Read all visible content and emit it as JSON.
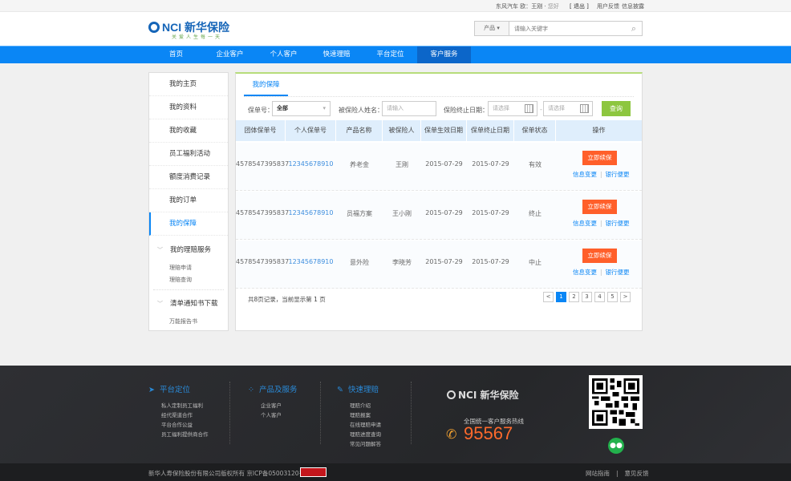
{
  "topbar": {
    "greeting": "东风汽车 ",
    "user_prefix": "欧：王刚 · ",
    "hello": "您好",
    "logout": "[ 退出 ]",
    "feedback": "用户反馈",
    "disclosure": "信息披露"
  },
  "header": {
    "logo_text": "NCI 新华保险",
    "slogan": "关爱人生每一天",
    "search_category": "产品",
    "search_placeholder": "请输入关键字"
  },
  "nav": {
    "items": [
      "首页",
      "企业客户",
      "个人客户",
      "快速理赔",
      "平台定位",
      "客户服务"
    ],
    "active": "客户服务",
    "color": "#0a86f5"
  },
  "sidebar": {
    "items": [
      "我的主页",
      "我的资料",
      "我的收藏",
      "员工福利活动",
      "额度消费记录",
      "我的订单",
      "我的保障"
    ],
    "active": "我的保障",
    "groups": [
      {
        "title": "我的理赔服务",
        "subs": [
          "理赔申请",
          "理赔查询"
        ]
      },
      {
        "title": "清单通知书下载",
        "subs": [
          "万能报告书"
        ]
      }
    ]
  },
  "main": {
    "tab": "我的保障",
    "filters": {
      "policy_label": "保单号：",
      "policy_value": "全部",
      "insured_label": "被保险人姓名：",
      "insured_placeholder": "请输入",
      "end_date_label": "保险终止日期：",
      "date_placeholder": "请选择",
      "date_sep": "-",
      "query": "查询"
    },
    "columns": [
      "团体保单号",
      "个人保单号",
      "产品名称",
      "被保险人",
      "保单生效日期",
      "保单终止日期",
      "保单状态",
      "操作"
    ],
    "rows": [
      {
        "group_no": "4578547395837",
        "personal_no": "12345678910",
        "product": "养老金",
        "insured": "王刚",
        "start": "2015-07-29",
        "end": "2015-07-29",
        "status": "有效"
      },
      {
        "group_no": "4578547395837",
        "personal_no": "12345678910",
        "product": "员福方案",
        "insured": "王小刚",
        "start": "2015-07-29",
        "end": "2015-07-29",
        "status": "终止"
      },
      {
        "group_no": "4578547395837",
        "personal_no": "12345678910",
        "product": "意外险",
        "insured": "李晓芳",
        "start": "2015-07-29",
        "end": "2015-07-29",
        "status": "中止"
      }
    ],
    "actions": {
      "renew": "立即续保",
      "info_change": "信息变更",
      "bank_change": "银行便更",
      "sep": "|"
    },
    "summary": "共8页记录，当前显示第 1 页",
    "pager": {
      "prev": "<",
      "pages": [
        "1",
        "2",
        "3",
        "4",
        "5"
      ],
      "current": "1",
      "next": ">"
    }
  },
  "footer": {
    "cols": [
      {
        "title": "平台定位",
        "icon": "send-icon",
        "links": [
          "私人定制员工福利",
          "经代渠道合作",
          "平台合作公益",
          "员工福利提供商合作"
        ]
      },
      {
        "title": "产品及服务",
        "icon": "grid-icon",
        "links": [
          "企业客户",
          "个人客户"
        ]
      },
      {
        "title": "快速理赔",
        "icon": "claim-icon",
        "links": [
          "理赔介绍",
          "理赔报案",
          "在线理赔申请",
          "理赔进度查询",
          "常见问题解答"
        ]
      }
    ],
    "logo_text": "NCI 新华保险",
    "hotline_label": "全国统一客户服务热线",
    "hotline": "95567",
    "copyright": "新华人寿保险股份有限公司版权所有 京ICP备05003120号",
    "bottom_links": [
      "网站指南",
      "意见反馈"
    ],
    "bottom_sep": "|"
  }
}
